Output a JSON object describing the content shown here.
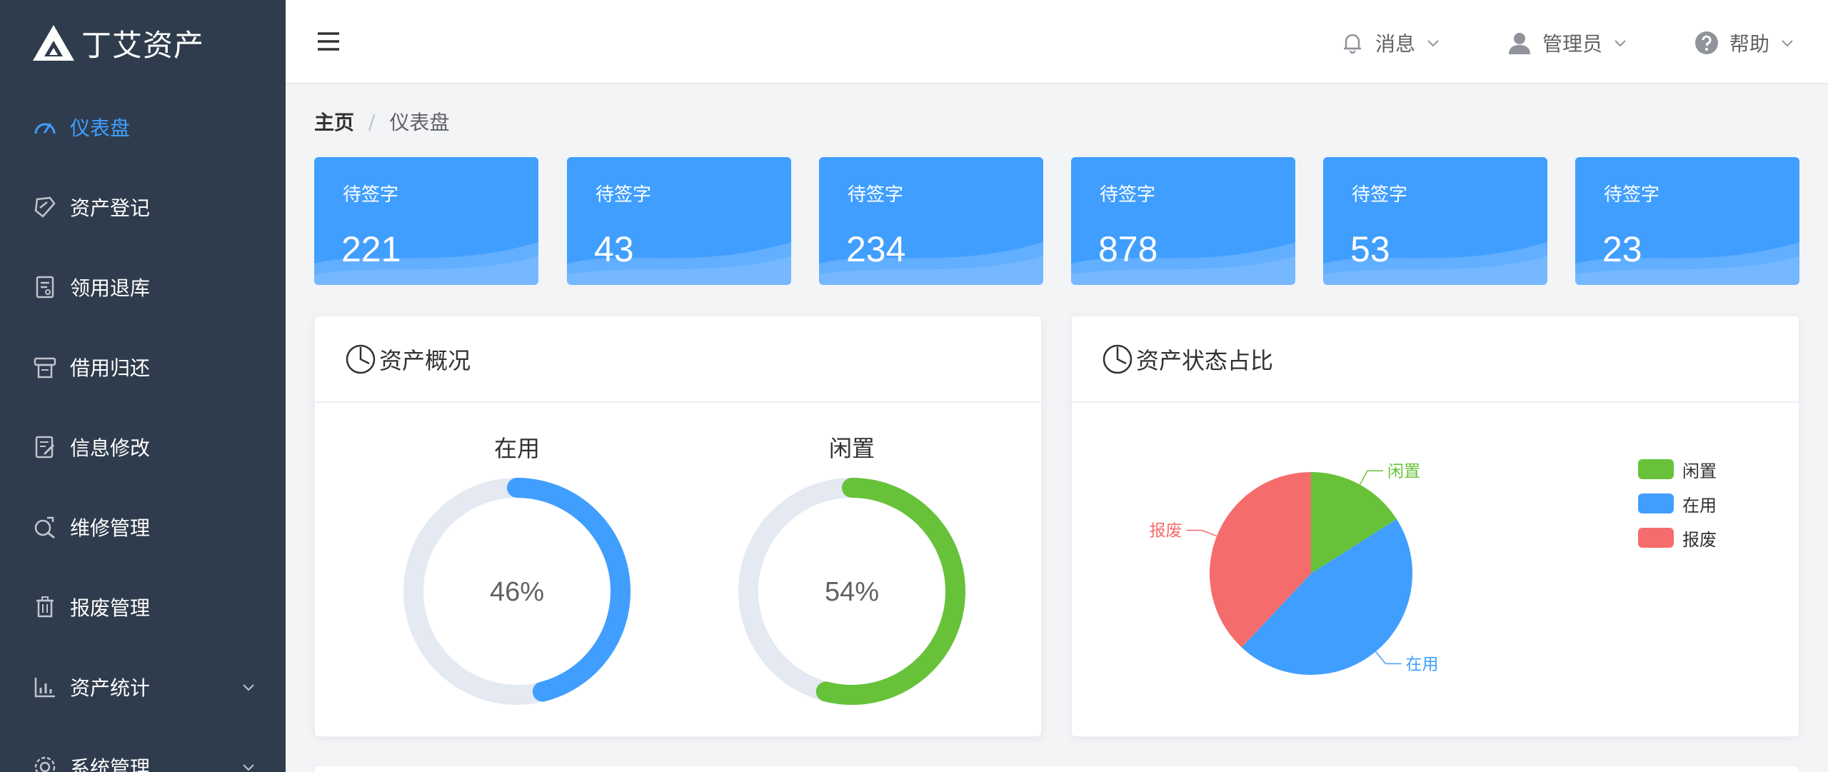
{
  "app": {
    "name": "丁艾资产"
  },
  "sidebar": {
    "items": [
      {
        "label": "仪表盘",
        "icon": "gauge-icon",
        "active": true
      },
      {
        "label": "资产登记",
        "icon": "register-icon"
      },
      {
        "label": "领用退库",
        "icon": "document-icon"
      },
      {
        "label": "借用归还",
        "icon": "printer-icon"
      },
      {
        "label": "信息修改",
        "icon": "edit-document-icon"
      },
      {
        "label": "维修管理",
        "icon": "wrench-search-icon"
      },
      {
        "label": "报废管理",
        "icon": "trash-icon"
      },
      {
        "label": "资产统计",
        "icon": "bar-chart-icon",
        "expandable": true
      },
      {
        "label": "系统管理",
        "icon": "settings-icon",
        "expandable": true
      }
    ]
  },
  "header": {
    "messages_label": "消息",
    "user_label": "管理员",
    "help_label": "帮助"
  },
  "breadcrumb": {
    "home": "主页",
    "separator": "/",
    "current": "仪表盘"
  },
  "stat_cards": [
    {
      "label": "待签字",
      "value": "221"
    },
    {
      "label": "待签字",
      "value": "43"
    },
    {
      "label": "待签字",
      "value": "234"
    },
    {
      "label": "待签字",
      "value": "878"
    },
    {
      "label": "待签字",
      "value": "53"
    },
    {
      "label": "待签字",
      "value": "23"
    }
  ],
  "overview_panel": {
    "title": "资产概况",
    "gauges": [
      {
        "title": "在用",
        "percent_text": "46%",
        "percent": 0.46,
        "color": "#409eff"
      },
      {
        "title": "闲置",
        "percent_text": "54%",
        "percent": 0.54,
        "color": "#67c23a"
      }
    ],
    "track_color": "#e4e9f2"
  },
  "status_panel": {
    "title": "资产状态占比",
    "legend": [
      {
        "label": "闲置",
        "color": "#67c23a"
      },
      {
        "label": "在用",
        "color": "#409eff"
      },
      {
        "label": "报废",
        "color": "#f56c6c"
      }
    ]
  },
  "chart_data": {
    "type": "pie",
    "labels": [
      "闲置",
      "在用",
      "报废"
    ],
    "values": [
      16,
      46,
      38
    ],
    "colors": [
      "#67c23a",
      "#409eff",
      "#f56c6c"
    ],
    "legend": "right"
  }
}
